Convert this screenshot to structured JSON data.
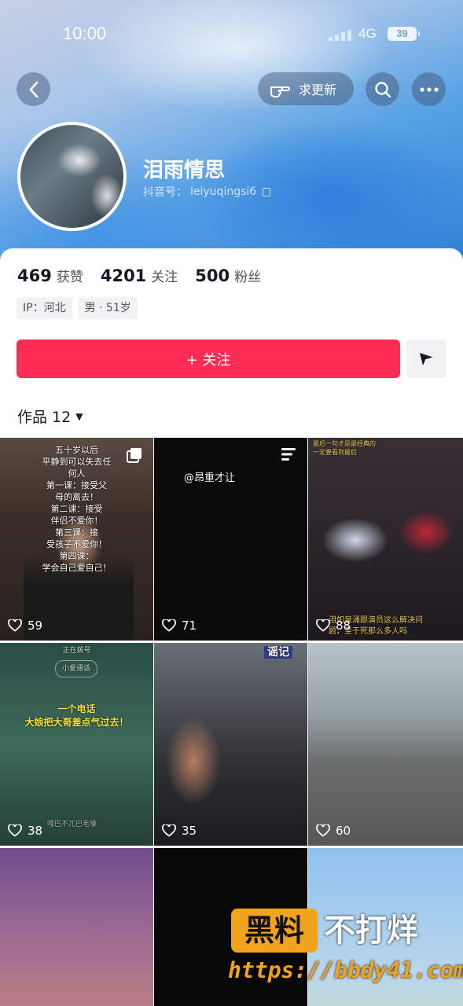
{
  "status": {
    "time": "10:00",
    "network": "4G",
    "battery": "39"
  },
  "top_actions": {
    "update_label": "求更新"
  },
  "profile": {
    "nickname": "泪雨情思",
    "douyin_id_label": "抖音号：",
    "douyin_id": "leiyuqingsi6",
    "stats": [
      {
        "value": "469",
        "label": "获赞"
      },
      {
        "value": "4201",
        "label": "关注"
      },
      {
        "value": "500",
        "label": "粉丝"
      }
    ],
    "tags": [
      "IP：河北",
      "男 · 51岁"
    ]
  },
  "actions": {
    "follow_label": "+ 关注"
  },
  "works": {
    "tab_label": "作品 12"
  },
  "videos": [
    {
      "likes": "59",
      "overlay": "五十岁以后\n平静到可以失去任\n何人\n第一课：接受父\n母的离去！\n第二课：接受\n伴侣不爱你！\n第三课：接\n受孩子不爱你！\n第四课：\n学会自己爱自己！"
    },
    {
      "likes": "71",
      "overlay": "@昂重才让"
    },
    {
      "likes": "88",
      "overlay": "最后一句才是最经典的\n一定要看到最后",
      "bottom_caption": "泪如泉涌跟演员这么解决问\n题，至于死那么多人吗"
    },
    {
      "likes": "38",
      "overlay": "正在拨号",
      "call_name": "小爱通话",
      "caption": "一个电话\n大娘把大哥差点气过去！",
      "footer": "嘎巴不兀巴毛嗓"
    },
    {
      "likes": "35",
      "overlay": "谣记"
    },
    {
      "likes": "60",
      "overlay": ""
    },
    {
      "likes": "",
      "overlay": ""
    },
    {
      "likes": "",
      "overlay": ""
    },
    {
      "likes": "",
      "overlay": ""
    }
  ],
  "watermark": {
    "box": "黑料",
    "text": "不打烊",
    "url": "https://bbdy41.com"
  },
  "colors": {
    "follow_red": "#fe2c55",
    "accent_orange": "#f2a31e"
  }
}
